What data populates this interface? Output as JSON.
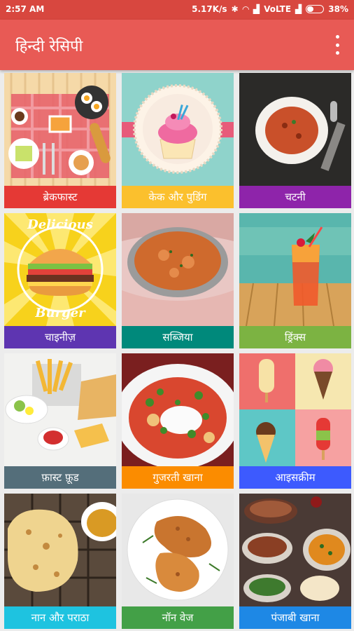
{
  "status_bar": {
    "time": "2:57 AM",
    "speed": "5.17K/s",
    "network": "VoLTE",
    "battery": "38%",
    "battery_level": 0.38
  },
  "app_bar": {
    "title": "हिन्दी रेसिपी",
    "menu_icon": "more-vert-icon"
  },
  "categories": [
    {
      "label": "ब्रेकफास्ट",
      "color": "#e53935"
    },
    {
      "label": "केक और पुडिंग",
      "color": "#fbc02d"
    },
    {
      "label": "चटनी",
      "color": "#8e24aa"
    },
    {
      "label": "चाइनीज़",
      "color": "#5e35b1"
    },
    {
      "label": "सब्जिया",
      "color": "#00897b"
    },
    {
      "label": "ड्रिंक्स",
      "color": "#7cb342"
    },
    {
      "label": "फ़ास्ट फ़ूड",
      "color": "#546e7a"
    },
    {
      "label": "गुजरती खाना",
      "color": "#fb8c00"
    },
    {
      "label": "आइसक्रीम",
      "color": "#3d5afe"
    },
    {
      "label": "नान और पराठा",
      "color": "#1ec3e0"
    },
    {
      "label": "नॉन वेज",
      "color": "#43a047"
    },
    {
      "label": "पंजाबी खाना",
      "color": "#1e88e5"
    }
  ],
  "image_texts": {
    "delicious": "Delicious",
    "burger": "Burger"
  }
}
